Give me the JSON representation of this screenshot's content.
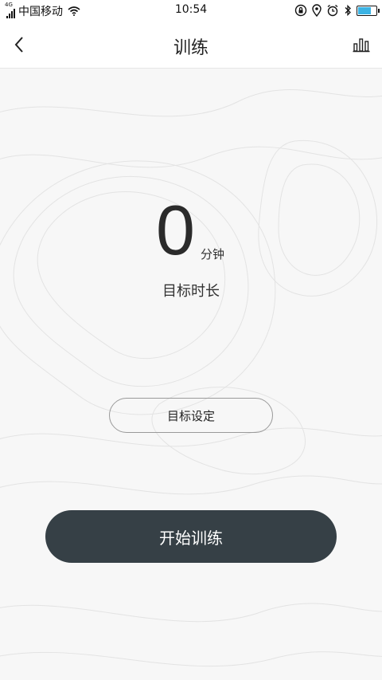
{
  "status_bar": {
    "network_type": "4G",
    "carrier": "中国移动",
    "time": "10:54",
    "battery_percent": 65
  },
  "nav": {
    "title": "训练"
  },
  "target": {
    "value": "0",
    "unit": "分钟",
    "label": "目标时长"
  },
  "buttons": {
    "set_goal": "目标设定",
    "start": "开始训练"
  },
  "colors": {
    "start_button": "#364046",
    "background": "#f7f7f7"
  }
}
